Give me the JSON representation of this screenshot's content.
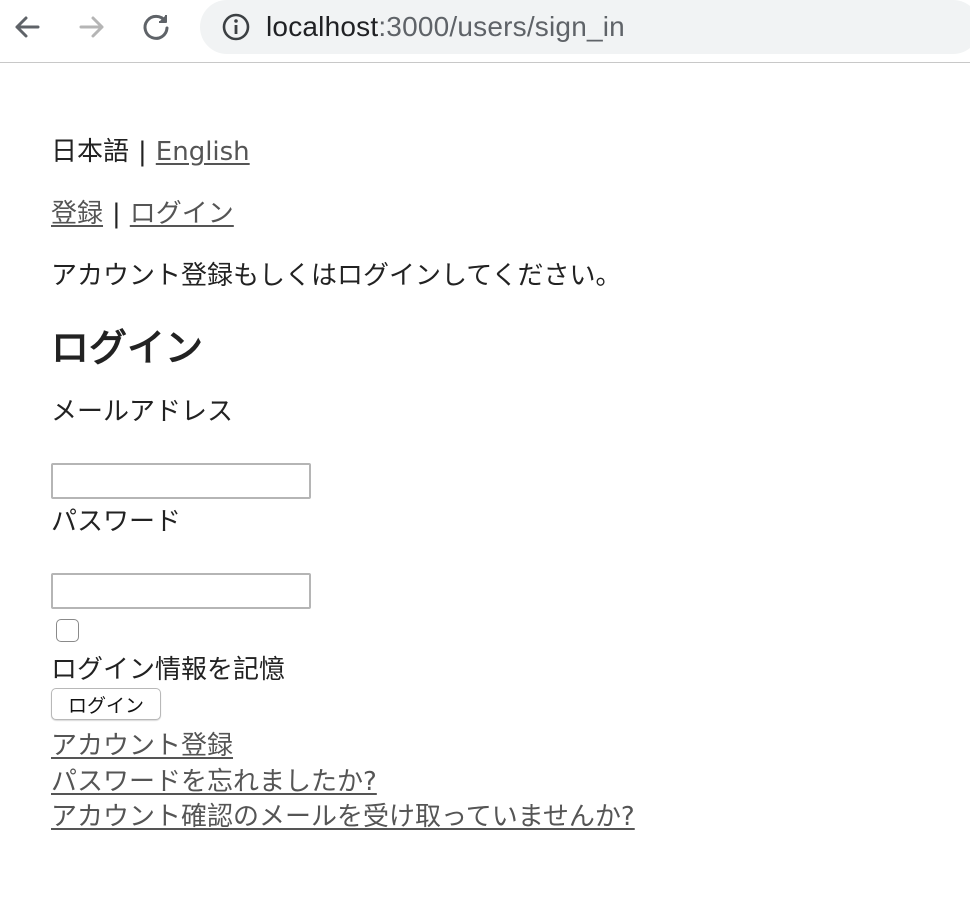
{
  "browser": {
    "url_host": "localhost",
    "url_path": ":3000/users/sign_in",
    "icons": [
      "back-arrow-icon",
      "forward-arrow-icon",
      "reload-icon",
      "info-icon"
    ]
  },
  "language": {
    "japanese": "日本語",
    "separator": "|",
    "english": "English"
  },
  "auth_nav": {
    "signup": "登録",
    "separator": "|",
    "login": "ログイン"
  },
  "notice": "アカウント登録もしくはログインしてください。",
  "heading": "ログイン",
  "form": {
    "email_label": "メールアドレス",
    "email_value": "",
    "password_label": "パスワード",
    "password_value": "",
    "remember_label": "ログイン情報を記憶",
    "remember_checked": false,
    "submit_label": "ログイン"
  },
  "links": {
    "signup": "アカウント登録",
    "forgot_password": "パスワードを忘れましたか?",
    "resend_confirmation": "アカウント確認のメールを受け取っていませんか?"
  },
  "colors": {
    "link": "#555555",
    "omnibox_bg": "#f1f3f4"
  }
}
